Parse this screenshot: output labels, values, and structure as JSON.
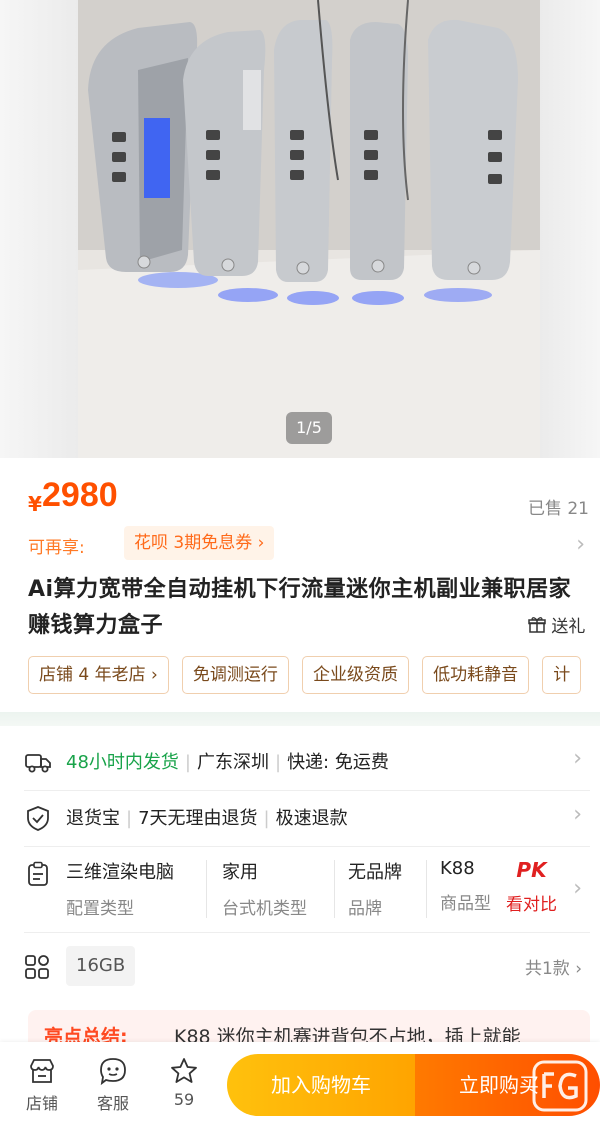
{
  "gallery": {
    "counter": "1/5"
  },
  "price": {
    "symbol": "¥",
    "value": "2980",
    "sold": "已售 21"
  },
  "coupon": {
    "prefix": "可再享:",
    "tag": "花呗 3期免息券 ›"
  },
  "product": {
    "title": "Ai算力宽带全自动挂机下行流量迷你主机副业兼职居家赚钱算力盒子",
    "gift_label": "送礼"
  },
  "tags": [
    "店铺 4 年老店 ›",
    "免调测运行",
    "企业级资质",
    "低功耗静音",
    "计"
  ],
  "service": {
    "shipping": {
      "speed": "48小时内发货",
      "origin": "广东深圳",
      "express": "快递: 免运费"
    },
    "returns": {
      "name": "退货宝",
      "policy": "7天无理由退货",
      "refund": "极速退款"
    }
  },
  "specs": [
    {
      "value": "三维渲染电脑",
      "key": "配置类型"
    },
    {
      "value": "家用",
      "key": "台式机类型"
    },
    {
      "value": "无品牌",
      "key": "品牌"
    },
    {
      "value": "K88",
      "key": "商品型"
    }
  ],
  "compare": {
    "badge": "PK",
    "label": "看对比"
  },
  "variant": {
    "chip": "16GB",
    "count": "共1款 ›"
  },
  "highlight": {
    "label": "亮点总结:",
    "text": "K88 迷你主机赛进背包不占地，插上就能"
  },
  "bottom_bar": {
    "store": "店铺",
    "service": "客服",
    "favorites": "59",
    "add_cart": "加入购物车",
    "buy_now": "立即购买"
  },
  "colors": {
    "accent": "#ff5000",
    "green": "#19a34a",
    "cart_yellow": "#ffb300",
    "buy_orange": "#ff5a00"
  }
}
